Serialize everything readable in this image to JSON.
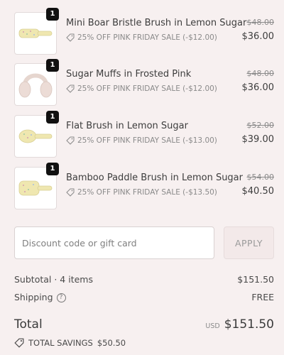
{
  "cart": {
    "items": [
      {
        "quantity": "1",
        "title": "Mini Boar Bristle Brush in Lemon Sugar",
        "discount": "25% OFF PINK FRIDAY SALE (-$12.00)",
        "original_price": "$48.00",
        "price": "$36.00",
        "image": "mini-brush-image"
      },
      {
        "quantity": "1",
        "title": "Sugar Muffs in Frosted Pink",
        "discount": "25% OFF PINK FRIDAY SALE (-$12.00)",
        "original_price": "$48.00",
        "price": "$36.00",
        "image": "earmuffs-image"
      },
      {
        "quantity": "1",
        "title": "Flat Brush in Lemon Sugar",
        "discount": "25% OFF PINK FRIDAY SALE (-$13.00)",
        "original_price": "$52.00",
        "price": "$39.00",
        "image": "flat-brush-image"
      },
      {
        "quantity": "1",
        "title": "Bamboo Paddle Brush in Lemon Sugar",
        "discount": "25% OFF PINK FRIDAY SALE (-$13.50)",
        "original_price": "$54.00",
        "price": "$40.50",
        "image": "paddle-brush-image"
      }
    ]
  },
  "discount_code": {
    "placeholder": "Discount code or gift card",
    "value": "",
    "apply_label": "APPLY"
  },
  "summary": {
    "subtotal_label": "Subtotal · 4 items",
    "subtotal_value": "$151.50",
    "shipping_label": "Shipping",
    "shipping_value": "FREE",
    "total_label": "Total",
    "currency": "USD",
    "total_value": "$151.50",
    "savings_label": "TOTAL SAVINGS",
    "savings_value": "$50.50"
  },
  "colors": {
    "background": "#f7f0f0",
    "text": "#4a4a4a",
    "muted": "#8a8a8a",
    "badge": "#111111",
    "apply_button_bg": "#f3e9e9",
    "product_yellow": "#efe7b0",
    "product_pink": "#ecdcd6"
  }
}
